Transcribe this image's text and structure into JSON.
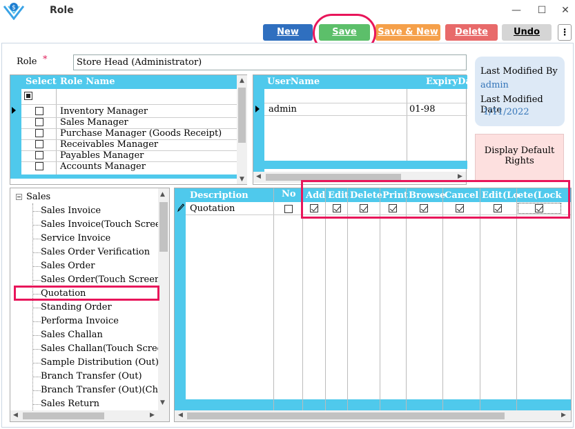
{
  "window": {
    "title": "Role",
    "minimize": "—",
    "maximize": "☐",
    "close": "✕"
  },
  "toolbar": {
    "new_label": "New",
    "save_label": "Save",
    "save_new_label": "Save & New",
    "delete_label": "Delete",
    "undo_label": "Undo",
    "more_label": "⋮",
    "colors": {
      "new": "#2f6fbf",
      "save": "#5cbf6a",
      "save_new": "#f5a04a",
      "delete": "#e86a6a",
      "undo": "#d5d5d5"
    }
  },
  "role": {
    "label": "Role",
    "required_mark": "*",
    "value": "Store Head (Administrator)"
  },
  "roles_grid": {
    "headers": {
      "select": "Select",
      "role_name": "Role Name"
    },
    "rows": [
      {
        "name": "Inventory Manager"
      },
      {
        "name": "Sales Manager"
      },
      {
        "name": "Purchase Manager (Goods Receipt)"
      },
      {
        "name": "Receivables Manager"
      },
      {
        "name": "Payables Manager"
      },
      {
        "name": "Accounts Manager"
      }
    ]
  },
  "users_grid": {
    "headers": {
      "username": "UserName",
      "expiry": "ExpiryDa"
    },
    "rows": [
      {
        "username": "admin",
        "expiry": "01-98"
      }
    ]
  },
  "info": {
    "modified_by_label": "Last Modified By",
    "modified_by": "admin",
    "modified_date_label": "Last Modified Date",
    "modified_date": "1/11/2022"
  },
  "display_default": {
    "label_line1": "Display Default",
    "label_line2": "Rights"
  },
  "tree": {
    "root": "Sales",
    "items": [
      "Sales Invoice",
      "Sales Invoice(Touch Screen",
      "Service Invoice",
      "Sales Order Verification",
      "Sales Order",
      "Sales Order(Touch Screen)",
      "Quotation",
      "Standing Order",
      "Performa Invoice",
      "Sales Challan",
      "Sales Challan(Touch Screen",
      "Sample Distribution (Out)",
      "Branch Transfer (Out)",
      "Branch Transfer (Out)(Cha",
      "Sales Return"
    ]
  },
  "rights_grid": {
    "headers": [
      "Description",
      "No",
      "Add",
      "Edit",
      "Delete",
      "Print",
      "Browse",
      "Cancel",
      "Edit(Lo",
      "ete(Lock"
    ],
    "row": {
      "description": "Quotation"
    }
  }
}
